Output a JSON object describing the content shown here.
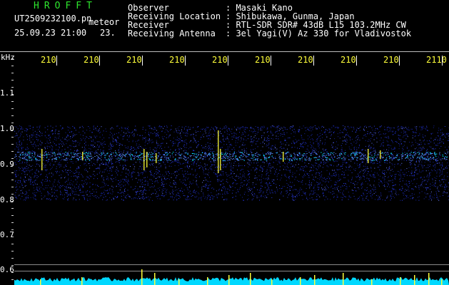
{
  "header": {
    "title": "HROFFT",
    "filename": "UT2509232100.pn",
    "mode": "meteor",
    "datetime": "25.09.23 21:00",
    "hour": "23.",
    "labels": {
      "observer": "Observer",
      "location": "Receiving Location",
      "receiver": "Receiver",
      "antenna": "Receiving Antenna"
    },
    "values": {
      "observer": ": Masaki Kano",
      "location": ": Shibukawa, Gunma, Japan",
      "receiver": ": RTL-SDR SDR# 43dB L15 103.2MHz CW",
      "antenna": ": 3el Yagi(V) Az 330 for Vladivostok"
    }
  },
  "axis": {
    "unit": "kHz",
    "x_ticks": [
      "210",
      "210",
      "210",
      "210",
      "210",
      "210",
      "210",
      "210",
      "210",
      "2110"
    ],
    "y_ticks": [
      "1.1",
      "1.0",
      "0.9",
      "0.8",
      "0.7",
      "0.6"
    ]
  },
  "colors": {
    "title": "#2ee62e",
    "tick_text": "#ffff3a",
    "noise": "#1f2fd0",
    "signal": "#00e5ff",
    "spike": "#ffff3a"
  }
}
